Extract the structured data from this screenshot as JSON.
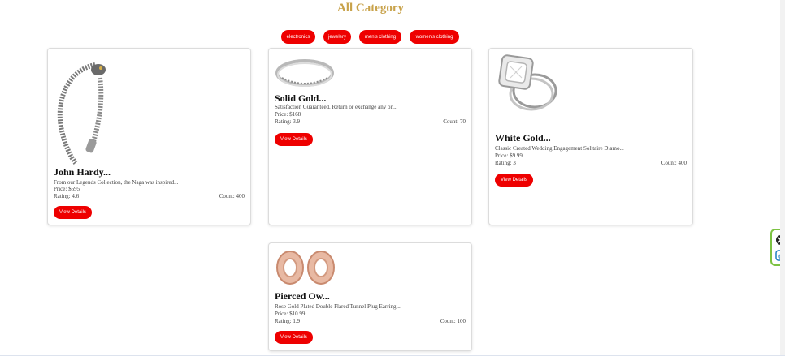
{
  "header": {
    "title": "All Category"
  },
  "categories": [
    "electronics",
    "jewelery",
    "men's clothing",
    "women's clothing"
  ],
  "products": [
    {
      "title": "John Hardy...",
      "description": "From our Legends Collection, the Naga was inspired...",
      "price": "Price: $695",
      "rating": "Rating: 4.6",
      "count": "Count: 400",
      "button": "View Details",
      "image": "silver-dragon-bracelet"
    },
    {
      "title": "Solid Gold...",
      "description": "Satisfaction Guaranteed. Return or exchange any or...",
      "price": "Price: $168",
      "rating": "Rating: 3.9",
      "count": "Count: 70",
      "button": "View Details",
      "image": "diamond-band-ring"
    },
    {
      "title": "White Gold...",
      "description": "Classic Created Wedding Engagement Solitaire Diamo...",
      "price": "Price: $9.99",
      "rating": "Rating: 3",
      "count": "Count: 400",
      "button": "View Details",
      "image": "engagement-ring-set"
    },
    {
      "title": "Pierced Ow...",
      "description": "Rose Gold Plated Double Flared Tunnel Plug Earring...",
      "price": "Price: $10.99",
      "rating": "Rating: 1.9",
      "count": "Count: 100",
      "button": "View Details",
      "image": "rose-gold-tunnel-plugs"
    }
  ],
  "colors": {
    "accent": "#ee0000",
    "title": "#c8a24a"
  },
  "widget": {
    "icons": [
      "close-icon",
      "extension-icon"
    ]
  }
}
